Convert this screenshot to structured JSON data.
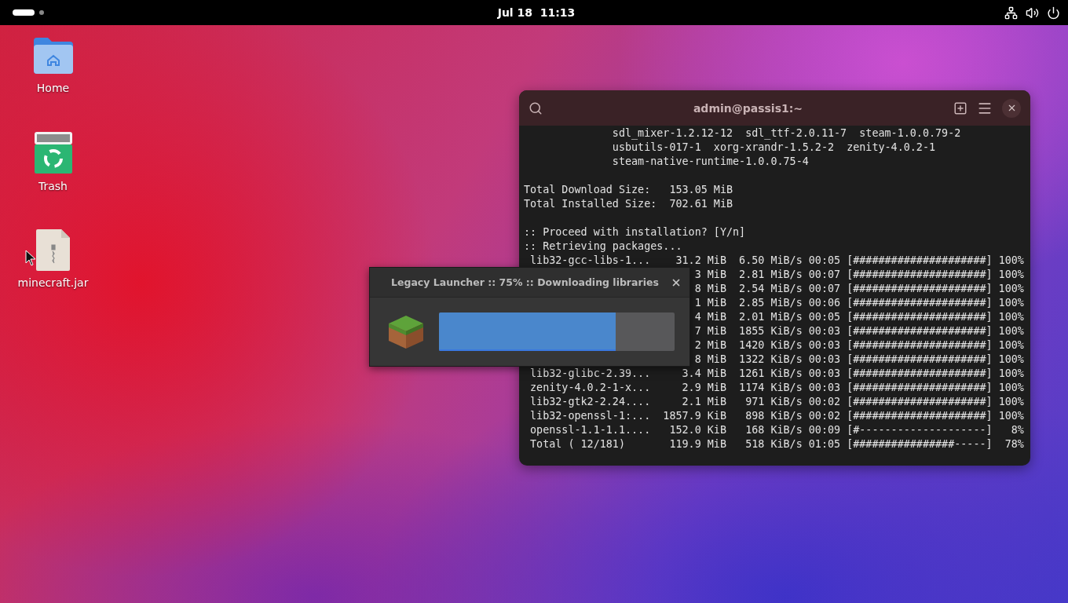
{
  "top_bar": {
    "clock": "Jul 18  11:13"
  },
  "desktop_icons": [
    {
      "kind": "folder",
      "label": "Home"
    },
    {
      "kind": "trash",
      "label": "Trash"
    },
    {
      "kind": "archive",
      "label": "minecraft.jar"
    }
  ],
  "terminal": {
    "title": "admin@passis1:~",
    "blocks": [
      [
        {
          "kind": "full",
          "text": "              sdl_mixer-1.2.12-12  sdl_ttf-2.0.11-7  steam-1.0.0.79-2"
        },
        {
          "kind": "full",
          "text": "              usbutils-017-1  xorg-xrandr-1.5.2-2  zenity-4.0.2-1"
        },
        {
          "kind": "full",
          "text": "              steam-native-runtime-1.0.0.75-4"
        }
      ],
      [
        {
          "kind": "full",
          "text": "Total Download Size:   153.05 MiB"
        },
        {
          "kind": "full",
          "text": "Total Installed Size:  702.61 MiB"
        }
      ],
      [
        {
          "kind": "full",
          "text": ":: Proceed with installation? [Y/n]"
        },
        {
          "kind": "full",
          "text": ":: Retrieving packages..."
        },
        {
          "kind": "full",
          "text": " lib32-gcc-libs-1...    31.2 MiB  6.50 MiB/s 00:05 [#####################] 100%"
        },
        {
          "kind": "partial",
          "text": "3 MiB  2.81 MiB/s 00:07 [#####################] 100%"
        },
        {
          "kind": "partial",
          "text": "8 MiB  2.54 MiB/s 00:07 [#####################] 100%"
        },
        {
          "kind": "partial",
          "text": "1 MiB  2.85 MiB/s 00:06 [#####################] 100%"
        },
        {
          "kind": "partial",
          "text": "4 MiB  2.01 MiB/s 00:05 [#####################] 100%"
        },
        {
          "kind": "partial",
          "text": "7 MiB  1855 KiB/s 00:03 [#####################] 100%"
        },
        {
          "kind": "partial",
          "text": "2 MiB  1420 KiB/s 00:03 [#####################] 100%"
        },
        {
          "kind": "partial",
          "text": "8 MiB  1322 KiB/s 00:03 [#####################] 100%"
        },
        {
          "kind": "full",
          "text": " lib32-glibc-2.39...     3.4 MiB  1261 KiB/s 00:03 [#####################] 100%"
        },
        {
          "kind": "full",
          "text": " zenity-4.0.2-1-x...     2.9 MiB  1174 KiB/s 00:03 [#####################] 100%"
        },
        {
          "kind": "full",
          "text": " lib32-gtk2-2.24....     2.1 MiB   971 KiB/s 00:02 [#####################] 100%"
        },
        {
          "kind": "full",
          "text": " lib32-openssl-1:...  1857.9 KiB   898 KiB/s 00:02 [#####################] 100%"
        },
        {
          "kind": "full",
          "text": " openssl-1.1-1.1....   152.0 KiB   168 KiB/s 00:09 [#--------------------]   8%"
        },
        {
          "kind": "full",
          "text": " Total ( 12/181)       119.9 MiB   518 KiB/s 01:05 [################-----]  78%"
        }
      ]
    ]
  },
  "launcher": {
    "title": "Legacy Launcher :: 75% :: Downloading libraries",
    "level": 0.75
  }
}
